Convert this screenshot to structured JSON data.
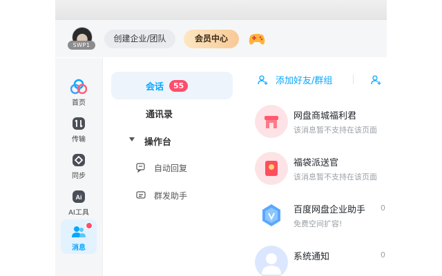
{
  "topbar": {
    "avatar_tag": "SWP1",
    "create_team_label": "创建企业/团队",
    "vip_center_label": "会员中心",
    "game_icon": "game-controller-icon"
  },
  "nav": {
    "items": [
      {
        "label": "首页",
        "icon": "home-cloud-icon",
        "active": false
      },
      {
        "label": "传输",
        "icon": "transfer-icon",
        "active": false
      },
      {
        "label": "同步",
        "icon": "sync-icon",
        "active": false
      },
      {
        "label": "AI工具",
        "icon": "ai-tools-icon",
        "active": false
      },
      {
        "label": "消息",
        "icon": "message-users-icon",
        "active": true,
        "has_dot": true
      }
    ]
  },
  "mid": {
    "session_label": "会话",
    "session_badge": "55",
    "contacts_label": "通讯录",
    "workbench_label": "操作台",
    "auto_reply_label": "自动回复",
    "group_assistant_label": "群发助手"
  },
  "chat": {
    "add_friend_label": "添加好友/群组",
    "conversations": [
      {
        "name": "网盘商城福利君",
        "preview": "该消息暂不支持在该页面",
        "time": "",
        "avatar": "shop-icon",
        "avatar_color": "#fde3e5"
      },
      {
        "name": "福袋派送官",
        "preview": "该消息暂不支持在该页面",
        "time": "",
        "avatar": "red-envelope-icon",
        "avatar_color": "#fde3e5"
      },
      {
        "name": "百度网盘企业助手",
        "preview": "免费空间扩容!",
        "time": "0",
        "avatar": "enterprise-shield-icon",
        "avatar_color": "#ffffff"
      },
      {
        "name": "系统通知",
        "preview": "",
        "time": "0",
        "avatar": "system-user-icon",
        "avatar_color": "#dbe7ff"
      }
    ]
  },
  "colors": {
    "accent": "#06a7ff",
    "badge": "#ff4d6a",
    "vip_gold": "#f7c997"
  }
}
